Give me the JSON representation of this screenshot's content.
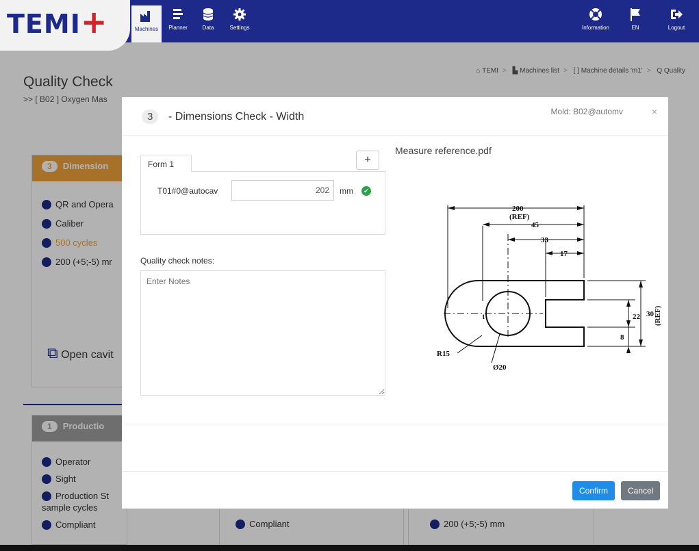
{
  "brand": {
    "logo_text": "TEMI",
    "logo_plus": "+"
  },
  "nav": [
    {
      "id": "machines",
      "label": "Machines",
      "icon": "factory-icon",
      "active": true
    },
    {
      "id": "planner",
      "label": "Planner",
      "icon": "list-icon",
      "active": false
    },
    {
      "id": "data",
      "label": "Data",
      "icon": "database-icon",
      "active": false
    },
    {
      "id": "settings",
      "label": "Settings",
      "icon": "gear-icon",
      "active": false
    }
  ],
  "nav_right": [
    {
      "id": "information",
      "label": "Information",
      "icon": "lifebuoy-icon"
    },
    {
      "id": "language",
      "label": "EN",
      "icon": "flag-icon"
    },
    {
      "id": "logout",
      "label": "Logout",
      "icon": "logout-icon"
    }
  ],
  "breadcrumb": [
    "TEMI",
    "Machines list",
    "Machine details 'm1'",
    "Quality"
  ],
  "page": {
    "title": "Quality Check",
    "subtitle": ">> [ B02 ] Oxygen Mas"
  },
  "cards": {
    "dimension": {
      "num": "3",
      "title": "Dimension",
      "rows": [
        "QR and Opera",
        "Caliber",
        "500 cycles",
        "200 (+5;-5) mr"
      ],
      "open_label": "Open cavit"
    },
    "production": {
      "num": "1",
      "title": "Productio",
      "rows": [
        "Operator",
        "Sight",
        "Production St",
        "sample cycles",
        "Compliant"
      ]
    },
    "bottom": {
      "compliant": "Compliant",
      "tolerance": "200 (+5;-5) mm"
    }
  },
  "modal": {
    "step": "3",
    "title": "- Dimensions Check - Width",
    "mold": "Mold: B02@automv",
    "close": "×",
    "tab_label": "Form 1",
    "add_label": "+",
    "field_label": "T01#0@autocav",
    "field_value": "202",
    "unit": "mm",
    "notes_label": "Quality check notes:",
    "notes_placeholder": "Enter Notes",
    "pdf_title": "Measure reference.pdf",
    "confirm_label": "Confirm",
    "cancel_label": "Cancel"
  },
  "drawing": {
    "dims": [
      "200",
      "(REF)",
      "45",
      "33",
      "17",
      "30",
      "(REF)",
      "22",
      "8",
      "R15",
      "Ø20",
      "1"
    ]
  },
  "colors": {
    "topbar": "#1d2a8a",
    "dimension_header": "#f0a23b",
    "production_header": "#9e9e9e",
    "confirm": "#1f8ce8",
    "cancel": "#707882",
    "check": "#2ea24a"
  }
}
